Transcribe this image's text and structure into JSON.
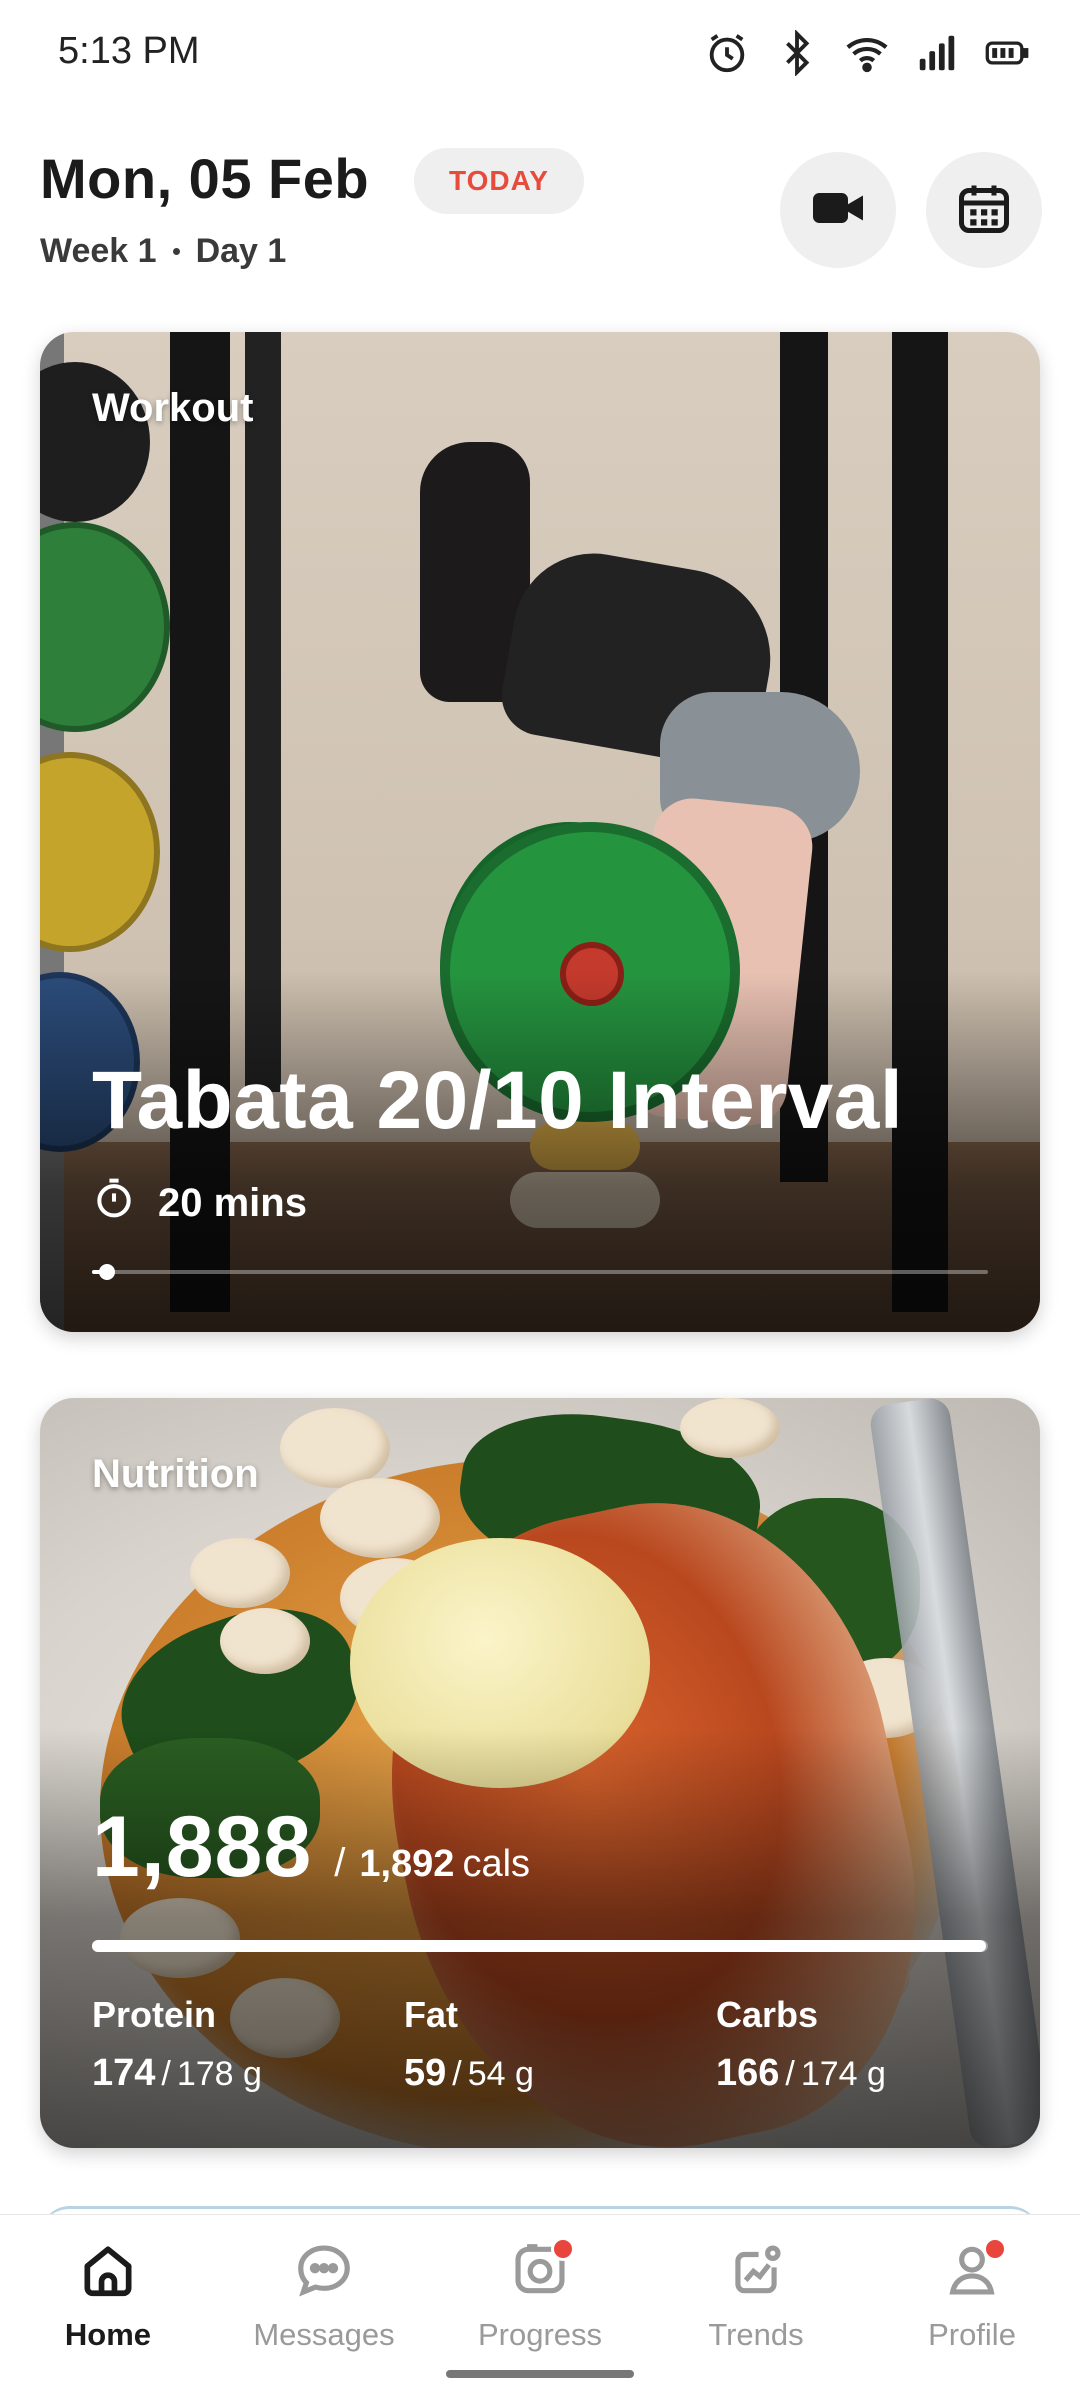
{
  "status_bar": {
    "time": "5:13 PM",
    "icons": [
      "alarm-icon",
      "bluetooth-icon",
      "wifi-icon",
      "signal-icon",
      "battery-icon"
    ]
  },
  "header": {
    "date": "Mon, 05 Feb",
    "today_badge": "TODAY",
    "week": "Week 1",
    "day": "Day 1",
    "buttons": [
      "video-camera-icon",
      "calendar-icon"
    ]
  },
  "workout": {
    "label": "Workout",
    "title": "Tabata 20/10 Interval",
    "duration": "20 mins",
    "progress": 0.01
  },
  "nutrition": {
    "label": "Nutrition",
    "calories_consumed": "1,888",
    "calories_separator": "/",
    "calories_target": "1,892",
    "calories_unit": "cals",
    "calories_progress": 0.998,
    "macros": [
      {
        "label": "Protein",
        "consumed": "174",
        "target": "178 g"
      },
      {
        "label": "Fat",
        "consumed": "59",
        "target": "54 g"
      },
      {
        "label": "Carbs",
        "consumed": "166",
        "target": "174 g"
      }
    ]
  },
  "bottom_nav": {
    "items": [
      {
        "label": "Home",
        "icon": "home-icon",
        "active": true,
        "badge": false
      },
      {
        "label": "Messages",
        "icon": "chat-icon",
        "active": false,
        "badge": false
      },
      {
        "label": "Progress",
        "icon": "camera-progress-icon",
        "active": false,
        "badge": true
      },
      {
        "label": "Trends",
        "icon": "trends-icon",
        "active": false,
        "badge": false
      },
      {
        "label": "Profile",
        "icon": "profile-icon",
        "active": false,
        "badge": true
      }
    ]
  },
  "colors": {
    "accent_red": "#e64b3c",
    "badge_red": "#e8453c",
    "chip_gray": "#efefef"
  }
}
